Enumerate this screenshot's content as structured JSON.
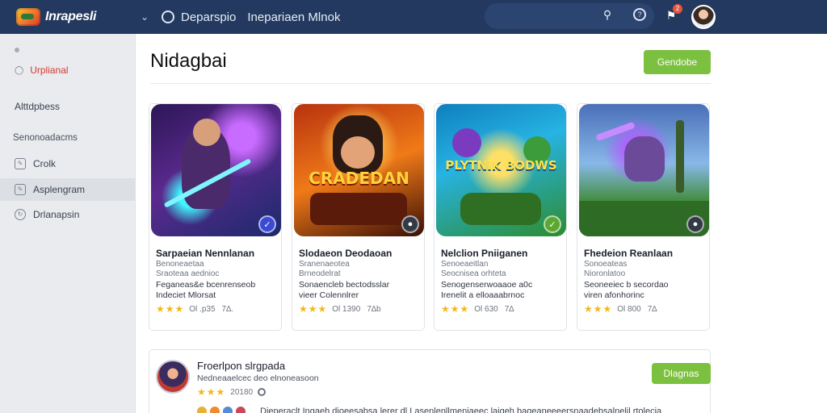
{
  "app": {
    "logo_text": "Inrapesli",
    "breadcrumb": "Deparspio",
    "breadcrumb_sub": "Inepariaen Mlnok",
    "notif_count": "2"
  },
  "sidebar": {
    "active_item": "Urplianal",
    "item_2": "Alttdpbess",
    "section_title": "Senonoadacms",
    "rows": [
      "Crolk",
      "Asplengram",
      "Drlanapsin"
    ]
  },
  "main": {
    "title": "Nidagbai",
    "top_button": "Gendobe"
  },
  "cards": [
    {
      "title": "Sarpaeian Nennlanan",
      "sub": "Benoneaetaa",
      "sub2": "Sraoteaa aednioc",
      "desc1": "Feganeas&e bcenrenseob",
      "desc2": "Indeciet Mlorsat",
      "stars": "★★★",
      "count": "Ol .p35",
      "extra": "7∆.",
      "badge_color": "#3b4bd1"
    },
    {
      "title": "Slodaeon Deodaoan",
      "sub": "Sranenaeotea",
      "sub2": "Brneodelrat",
      "desc1": "Sonaencleb bectodsslar",
      "desc2": "vieer Colennlrer",
      "stars": "★★★",
      "count": "Ol 1390",
      "extra": "7∆b",
      "art_word": "CRADEDAN",
      "badge_color": "#333a44"
    },
    {
      "title": "Nelclion Pniiganen",
      "sub": "Senoeaeitlan",
      "sub2": "Seocnisea orhteta",
      "desc1": "Senogenserwoaaoe a0c",
      "desc2": "Irenelit a elloaaabrnoc",
      "stars": "★★★",
      "count": "Ol 630",
      "extra": "7∆",
      "art_word": "PLYTNIK BODWS",
      "badge_color": "#5aa832"
    },
    {
      "title": "Fhedeion Reanlaan",
      "sub": "Sonoeateas",
      "sub2": "Nioronlatoo",
      "desc1": "Seoneeiec b secordao",
      "desc2": "viren afonhorinc",
      "stars": "★★★",
      "count": "Ol 800",
      "extra": "7∆",
      "badge_color": "#333a44"
    }
  ],
  "featured": {
    "title": "Froerlpon slrgpada",
    "sub": "Nedneaaelcec deo elnoneasoon",
    "stars": "★★★",
    "count": "20180",
    "button": "Dlagnas",
    "line": "Dieperaclt Ingaeh dioeesabsa lerer dl Lasenlenllmeniaeec laigeh bageaneeeersnaadebsalnelil rtolecia"
  },
  "colors": {
    "topbar": "#23395f",
    "accent_green": "#7cc03f",
    "active_red": "#d63a2f",
    "star": "#f2b71c"
  }
}
